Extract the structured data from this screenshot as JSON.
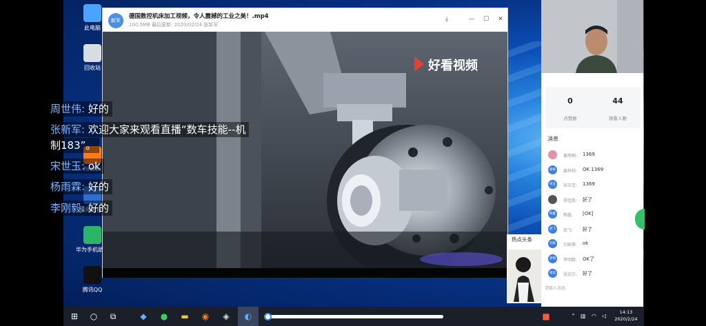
{
  "desktop": {
    "icons": [
      {
        "label": "此电脑",
        "icon": "computer-icon",
        "color": "#4aa3ff"
      },
      {
        "label": "回收站",
        "icon": "recycle-bin-icon",
        "color": "#d8dde4"
      },
      {
        "label": "Firefox",
        "icon": "firefox-icon",
        "color": "#ff7a1a"
      },
      {
        "label": "暴风影音5",
        "icon": "media-player-icon",
        "color": "#2d6fd6"
      },
      {
        "label": "华为手机助手",
        "icon": "phone-assistant-icon",
        "color": "#2db567"
      },
      {
        "label": "腾讯QQ",
        "icon": "qq-icon",
        "color": "#111111"
      }
    ]
  },
  "player": {
    "badge": "新军",
    "title": "德国数控机床加工视频，令人震撼的工业之美！.mp4",
    "meta": "100.5MB  最后更新: 2020/02/24 张新军",
    "watermark": "好看视频"
  },
  "chat_overlay": [
    {
      "name": "周世伟",
      "message": "好的"
    },
    {
      "name": "张新军",
      "message": "欢迎大家来观看直播“数车技能--机"
    },
    {
      "name": "",
      "message": "制183”。"
    },
    {
      "name": "宋世玉",
      "message": "ok"
    },
    {
      "name": "杨雨霖",
      "message": "好的"
    },
    {
      "name": "李刚毅",
      "message": "好的"
    }
  ],
  "right_panel": {
    "stats": [
      {
        "value": "0",
        "label": "点赞数"
      },
      {
        "value": "44",
        "label": "观看人数"
      }
    ],
    "messages_title": "消息",
    "messages": [
      {
        "avatar": "",
        "avatar_color": "#e88fb0",
        "name": "黄雨桐:",
        "text": "1369"
      },
      {
        "avatar": "姜梓",
        "avatar_color": "#3a7ee8",
        "name": "姜梓帅:",
        "text": "OK  1369"
      },
      {
        "avatar": "宋玉",
        "avatar_color": "#3a7ee8",
        "name": "宋玉宝:",
        "text": "1369"
      },
      {
        "avatar": "",
        "avatar_color": "#555555",
        "name": "郑佳航:",
        "text": "好了"
      },
      {
        "avatar": "陶鑫",
        "avatar_color": "#3a7ee8",
        "name": "陶鑫:",
        "text": "[OK]"
      },
      {
        "avatar": "武飞",
        "avatar_color": "#3a7ee8",
        "name": "武飞:",
        "text": "好了"
      },
      {
        "avatar": "刘家",
        "avatar_color": "#3a7ee8",
        "name": "刘家豪:",
        "text": "ok"
      },
      {
        "avatar": "李明",
        "avatar_color": "#3a7ee8",
        "name": "李明毅:",
        "text": "OK了"
      },
      {
        "avatar": "张远",
        "avatar_color": "#3a7ee8",
        "name": "张远方:",
        "text": "好了"
      }
    ],
    "input_placeholder": "请输入消息"
  },
  "news": {
    "title": "热点头条"
  },
  "taskbar": {
    "progress": 0.0,
    "clock_time": "14:13",
    "clock_date": "2020/2/24"
  },
  "colors": {
    "accent": "#2f8cff",
    "chat_name": "#7fb5ff"
  }
}
